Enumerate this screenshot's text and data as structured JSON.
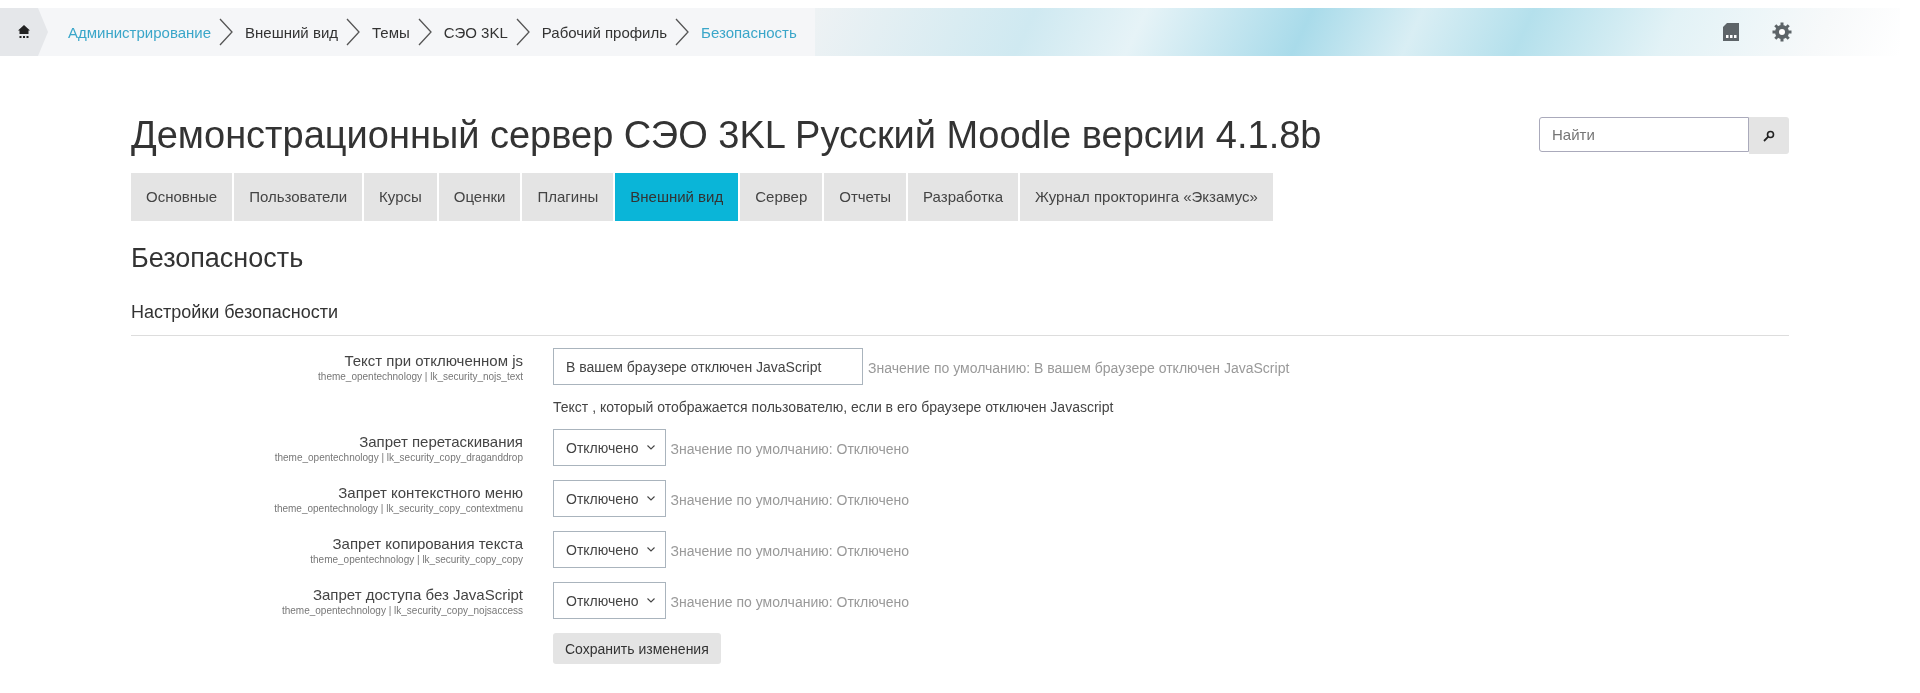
{
  "breadcrumb": [
    {
      "label": "Администрирование",
      "link": true
    },
    {
      "label": "Внешний вид",
      "link": false
    },
    {
      "label": "Темы",
      "link": false
    },
    {
      "label": "СЭО 3KL",
      "link": false
    },
    {
      "label": "Рабочий профиль",
      "link": false
    },
    {
      "label": "Безопасность",
      "link": true
    }
  ],
  "site_title": "Демонстрационный сервер СЭО 3KL Русский Moodle версии 4.1.8b",
  "search": {
    "placeholder": "Найти"
  },
  "tabs": [
    {
      "label": "Основные",
      "selected": false
    },
    {
      "label": "Пользователи",
      "selected": false
    },
    {
      "label": "Курсы",
      "selected": false
    },
    {
      "label": "Оценки",
      "selected": false
    },
    {
      "label": "Плагины",
      "selected": false
    },
    {
      "label": "Внешний вид",
      "selected": true
    },
    {
      "label": "Сервер",
      "selected": false
    },
    {
      "label": "Отчеты",
      "selected": false
    },
    {
      "label": "Разработка",
      "selected": false
    },
    {
      "label": "Журнал прокторинга «Экзамус»",
      "selected": false
    }
  ],
  "page_heading": "Безопасность",
  "section_heading": "Настройки безопасности",
  "settings": [
    {
      "kind": "text",
      "label": "Текст при отключенном js",
      "key": "theme_opentechnology | lk_security_nojs_text",
      "value": "В вашем браузере отключен JavaScript",
      "default": "Значение по умолчанию: В вашем браузере отключен JavaScript",
      "description": "Текст , который отображается пользователю, если в его браузере отключен Javascript"
    },
    {
      "kind": "select",
      "label": "Запрет перетаскивания",
      "key": "theme_opentechnology | lk_security_copy_draganddrop",
      "value": "Отключено",
      "default": "Значение по умолчанию: Отключено"
    },
    {
      "kind": "select",
      "label": "Запрет контекстного меню",
      "key": "theme_opentechnology | lk_security_copy_contextmenu",
      "value": "Отключено",
      "default": "Значение по умолчанию: Отключено"
    },
    {
      "kind": "select",
      "label": "Запрет копирования текста",
      "key": "theme_opentechnology | lk_security_copy_copy",
      "value": "Отключено",
      "default": "Значение по умолчанию: Отключено"
    },
    {
      "kind": "select",
      "label": "Запрет доступа без JavaScript",
      "key": "theme_opentechnology | lk_security_copy_nojsaccess",
      "value": "Отключено",
      "default": "Значение по умолчанию: Отключено"
    }
  ],
  "save_button": "Сохранить изменения"
}
